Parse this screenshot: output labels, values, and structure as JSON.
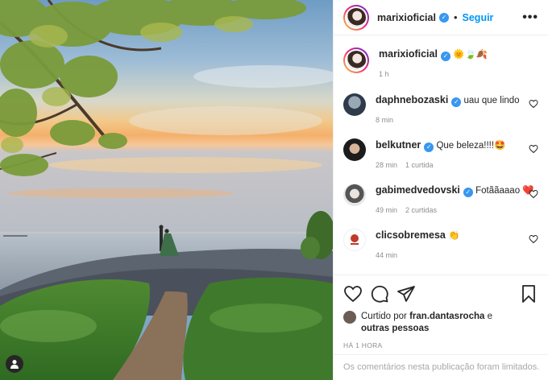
{
  "post": {
    "author": "marixioficial",
    "follow_label": "Seguir",
    "dot": "•",
    "more_icon": "more-horizontal-icon"
  },
  "caption": {
    "username": "marixioficial",
    "text": "🌞🍃🍂",
    "time": "1 h"
  },
  "comments": [
    {
      "username": "daphnebozaski",
      "verified": true,
      "text": "uau que lindo",
      "time": "8 min",
      "likes": ""
    },
    {
      "username": "belkutner",
      "verified": true,
      "text": "Que beleza!!!!🤩",
      "time": "28 min",
      "likes": "1 curtida"
    },
    {
      "username": "gabimedvedovski",
      "verified": true,
      "text": "Fotããaaao ❤️",
      "time": "49 min",
      "likes": "2 curtidas"
    },
    {
      "username": "clicsobremesa",
      "verified": false,
      "text": "👏",
      "time": "44 min",
      "likes": ""
    }
  ],
  "likes": {
    "prefix": "Curtido por ",
    "user": "fran.dantasrocha",
    "middle": " e ",
    "others": "outras pessoas"
  },
  "timestamp": "HÁ 1 HORA",
  "limited_comments": "Os comentários nesta publicação foram limitados.",
  "colors": {
    "accent": "#0095f6",
    "verified": "#3897f0",
    "muted": "#8e8e8e"
  }
}
